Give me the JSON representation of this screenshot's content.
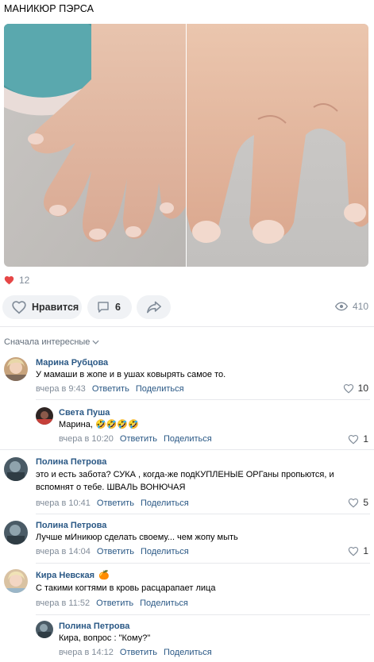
{
  "post": {
    "title": "МАНИКЮР ПЭРСА",
    "likes_count": "12"
  },
  "actions": {
    "like_label": "Нравится",
    "comments_count": "6",
    "views_count": "410"
  },
  "comments_sort": "Сначала интересные",
  "comments": [
    {
      "author": "Марина Рубцова",
      "text": "У мамаши в жопе и в ушах ковырять самое то.",
      "time": "вчера в 9:43",
      "reply": "Ответить",
      "share": "Поделиться",
      "likes": "10"
    },
    {
      "author": "Света Пуша",
      "text": "Марина, 🤣🤣🤣🤣",
      "time": "вчера в 10:20",
      "reply": "Ответить",
      "share": "Поделиться",
      "likes": "1"
    },
    {
      "author": "Полина Петрова",
      "text_line1": "это и есть забота? СУКА , когда-же подКУПЛЕНЫЕ ОРГаны пропьются, и",
      "text_line2": "вспомнят о тебе. ШВАЛЬ ВОНЮЧАЯ",
      "time": "вчера в 10:41",
      "reply": "Ответить",
      "share": "Поделиться",
      "likes": "5"
    },
    {
      "author": "Полина Петрова",
      "text": "Лучше мИникюр сделать своему... чем жопу мыть",
      "time": "вчера в 14:04",
      "reply": "Ответить",
      "share": "Поделиться",
      "likes": "1"
    },
    {
      "author": "Кира Невская",
      "author_badge": "🍊",
      "text": "С такими когтями в кровь расцарапает лица",
      "time": "вчера в 11:52",
      "reply": "Ответить",
      "share": "Поделиться"
    },
    {
      "author": "Полина Петрова",
      "text": "Кира, вопрос : \"Кому?\"",
      "time": "вчера в 14:12",
      "reply": "Ответить",
      "share": "Поделиться"
    }
  ],
  "colors": {
    "link": "#2a5885",
    "muted": "#818c99",
    "like_red": "#e64646",
    "button_bg": "#f0f2f5"
  }
}
